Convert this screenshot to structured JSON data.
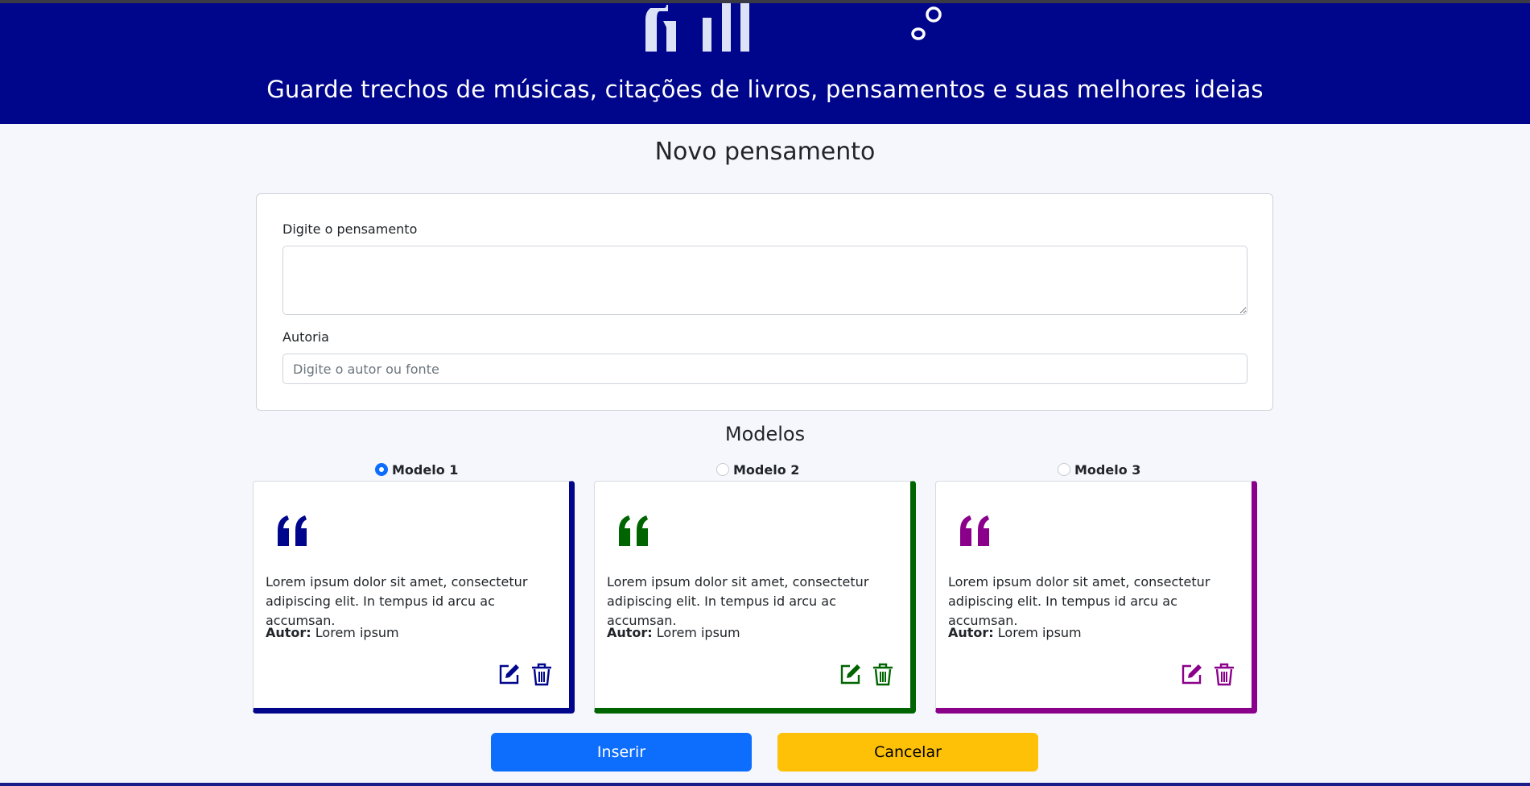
{
  "header": {
    "title": "Guarde trechos de músicas, citações de livros, pensamentos e suas melhores ideias",
    "logo_icon": "memoteca-logo"
  },
  "form": {
    "page_title": "Novo pensamento",
    "thought_label": "Digite o pensamento",
    "thought_value": "",
    "author_label": "Autoria",
    "author_placeholder": "Digite o autor ou fonte",
    "author_value": ""
  },
  "models": {
    "title": "Modelos",
    "selected": "Modelo 1",
    "items": [
      {
        "label": "Modelo 1",
        "checked": true,
        "color": "#00068b",
        "text": "Lorem ipsum dolor sit amet, consectetur adipiscing elit. In tempus id arcu ac accumsan.",
        "author_label": "Autor:",
        "author": "Lorem ipsum",
        "edit_icon": "edit-icon",
        "delete_icon": "trash-icon"
      },
      {
        "label": "Modelo 2",
        "checked": false,
        "color": "#006400",
        "text": "Lorem ipsum dolor sit amet, consectetur adipiscing elit. In tempus id arcu ac accumsan.",
        "author_label": "Autor:",
        "author": "Lorem ipsum",
        "edit_icon": "edit-icon",
        "delete_icon": "trash-icon"
      },
      {
        "label": "Modelo 3",
        "checked": false,
        "color": "#8b008b",
        "text": "Lorem ipsum dolor sit amet, consectetur adipiscing elit. In tempus id arcu ac accumsan.",
        "author_label": "Autor:",
        "author": "Lorem ipsum",
        "edit_icon": "edit-icon",
        "delete_icon": "trash-icon"
      }
    ]
  },
  "buttons": {
    "insert_label": "Inserir",
    "insert_color": "#0d6efd",
    "cancel_label": "Cancelar",
    "cancel_color": "#ffc107"
  }
}
